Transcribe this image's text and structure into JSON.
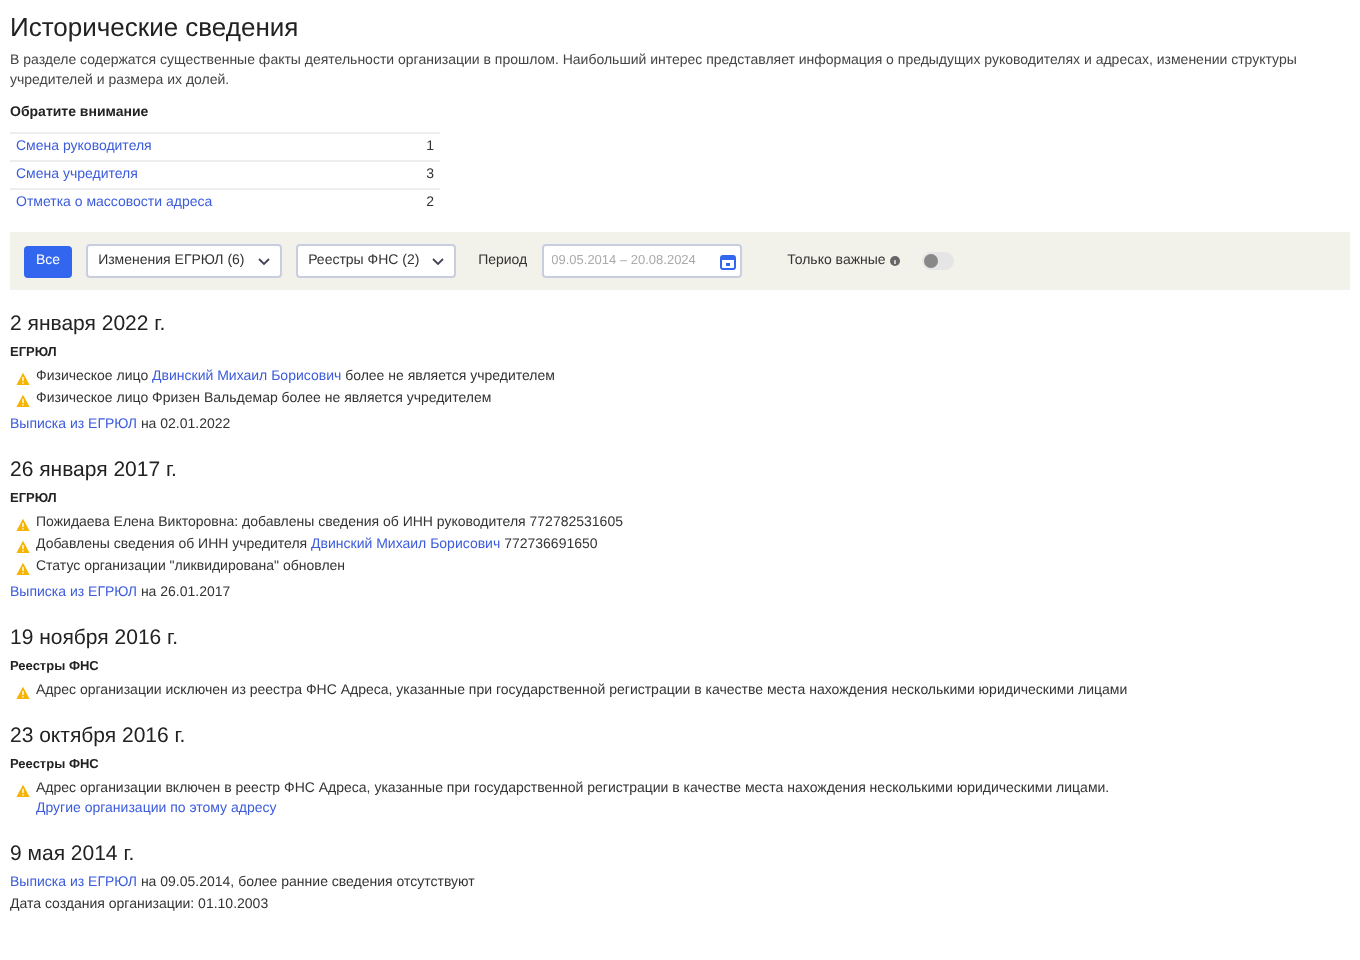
{
  "title": "Исторические сведения",
  "description": "В разделе содержатся существенные факты деятельности организации в прошлом. Наибольший интерес представляет информация о предыдущих руководителях и адресах, изменении структуры учредителей и размера их долей.",
  "attention": {
    "heading": "Обратите внимание",
    "rows": [
      {
        "label": "Смена руководителя",
        "count": "1"
      },
      {
        "label": "Смена учредителя",
        "count": "3"
      },
      {
        "label": "Отметка о массовости адреса",
        "count": "2"
      }
    ]
  },
  "filters": {
    "all_button": {
      "label": "Все",
      "selected": true
    },
    "dropdowns": [
      "Изменения ЕГРЮЛ (6)",
      "Реестры ФНС (2)"
    ],
    "period_label": "Период",
    "period_placeholder": "09.05.2014 – 20.08.2024",
    "important": {
      "label": "Только важные",
      "on": false
    }
  },
  "events": [
    {
      "date": "2 января 2022 г.",
      "source": "ЕГРЮЛ",
      "items": [
        [
          {
            "kind": "text",
            "text": "Физическое лицо "
          },
          {
            "kind": "link",
            "text": "Двинский Михаил Борисович"
          },
          {
            "kind": "text",
            "text": " более не является учредителем"
          }
        ],
        [
          {
            "kind": "text",
            "text": "Физическое лицо Фризен Вальдемар более не является учредителем"
          }
        ]
      ],
      "lines": [
        [
          {
            "kind": "link",
            "text": "Выписка из ЕГРЮЛ"
          },
          {
            "kind": "text",
            "text": " на 02.01.2022"
          }
        ]
      ]
    },
    {
      "date": "26 января 2017 г.",
      "source": "ЕГРЮЛ",
      "items": [
        [
          {
            "kind": "text",
            "text": "Пожидаева Елена Викторовна: добавлены сведения об ИНН руководителя 772782531605"
          }
        ],
        [
          {
            "kind": "text",
            "text": "Добавлены сведения об ИНН учредителя "
          },
          {
            "kind": "link",
            "text": "Двинский Михаил Борисович"
          },
          {
            "kind": "text",
            "text": " 772736691650"
          }
        ],
        [
          {
            "kind": "text",
            "text": "Статус организации \"ликвидирована\" обновлен"
          }
        ]
      ],
      "lines": [
        [
          {
            "kind": "link",
            "text": "Выписка из ЕГРЮЛ"
          },
          {
            "kind": "text",
            "text": " на 26.01.2017"
          }
        ]
      ]
    },
    {
      "date": "19 ноября 2016 г.",
      "source": "Реестры ФНС",
      "items": [
        [
          {
            "kind": "text",
            "text": "Адрес организации исключен из реестра ФНС Адреса, указанные при государственной регистрации в качестве места нахождения несколькими юридическими лицами"
          }
        ]
      ]
    },
    {
      "date": "23 октября 2016 г.",
      "source": "Реестры ФНС",
      "items": [
        [
          {
            "kind": "text",
            "text": "Адрес организации включен в реестр ФНС Адреса, указанные при государственной регистрации в качестве места нахождения несколькими юридическими лицами."
          }
        ]
      ],
      "item_link": "Другие организации по этому адресу"
    },
    {
      "date": "9 мая 2014 г.",
      "lines": [
        [
          {
            "kind": "link",
            "text": "Выписка из ЕГРЮЛ"
          },
          {
            "kind": "text",
            "text": " на 09.05.2014, более ранние сведения отсутствуют"
          }
        ],
        [
          {
            "kind": "text",
            "text": "Дата создания организации: 01.10.2003"
          }
        ]
      ]
    }
  ]
}
